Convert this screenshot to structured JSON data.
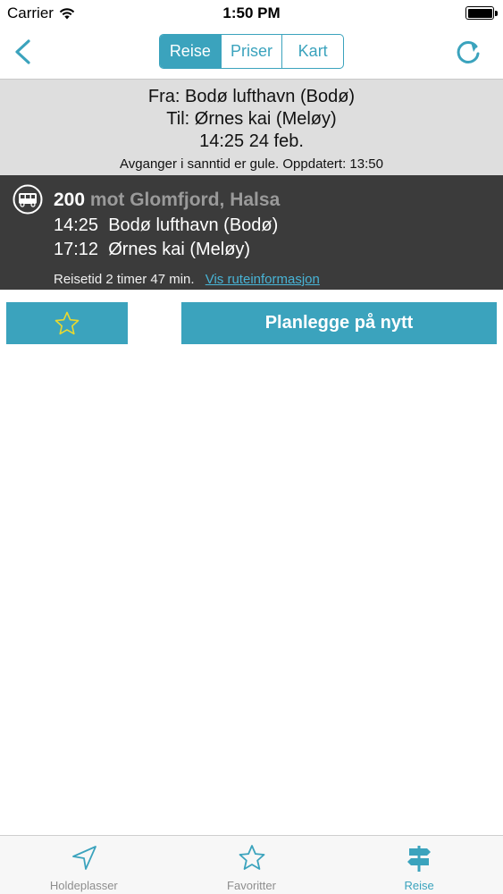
{
  "status_bar": {
    "carrier": "Carrier",
    "time": "1:50 PM",
    "wifi_icon": "wifi-icon",
    "battery_icon": "battery-icon"
  },
  "nav": {
    "back_icon": "chevron-left-icon",
    "refresh_icon": "refresh-icon",
    "segments": [
      {
        "label": "Reise",
        "active": true
      },
      {
        "label": "Priser",
        "active": false
      },
      {
        "label": "Kart",
        "active": false
      }
    ]
  },
  "summary": {
    "from": "Fra: Bodø lufthavn (Bodø)",
    "to": "Til: Ørnes kai (Meløy)",
    "datetime": "14:25 24 feb.",
    "realtime_note": "Avganger i sanntid er gule. Oppdatert: 13:50"
  },
  "route": {
    "icon": "bus-icon",
    "number": "200",
    "destination": "mot Glomfjord, Halsa",
    "departure_time": "14:25",
    "departure_stop": "Bodø lufthavn (Bodø)",
    "arrival_time": "17:12",
    "arrival_stop": "Ørnes kai (Meløy)",
    "travel_time": "Reisetid 2 timer 47 min.",
    "info_link": "Vis ruteinformasjon"
  },
  "actions": {
    "favorite_icon": "star-icon",
    "replan_label": "Planlegge på nytt"
  },
  "tabbar": {
    "tabs": [
      {
        "label": "Holdeplasser",
        "icon": "location-arrow-icon",
        "active": false
      },
      {
        "label": "Favoritter",
        "icon": "star-icon",
        "active": false
      },
      {
        "label": "Reise",
        "icon": "signpost-icon",
        "active": true
      }
    ]
  },
  "colors": {
    "accent": "#3ba3bd",
    "route_bg": "#3b3b3b",
    "summary_bg": "#dedede",
    "favorite_star": "#e8d930"
  }
}
